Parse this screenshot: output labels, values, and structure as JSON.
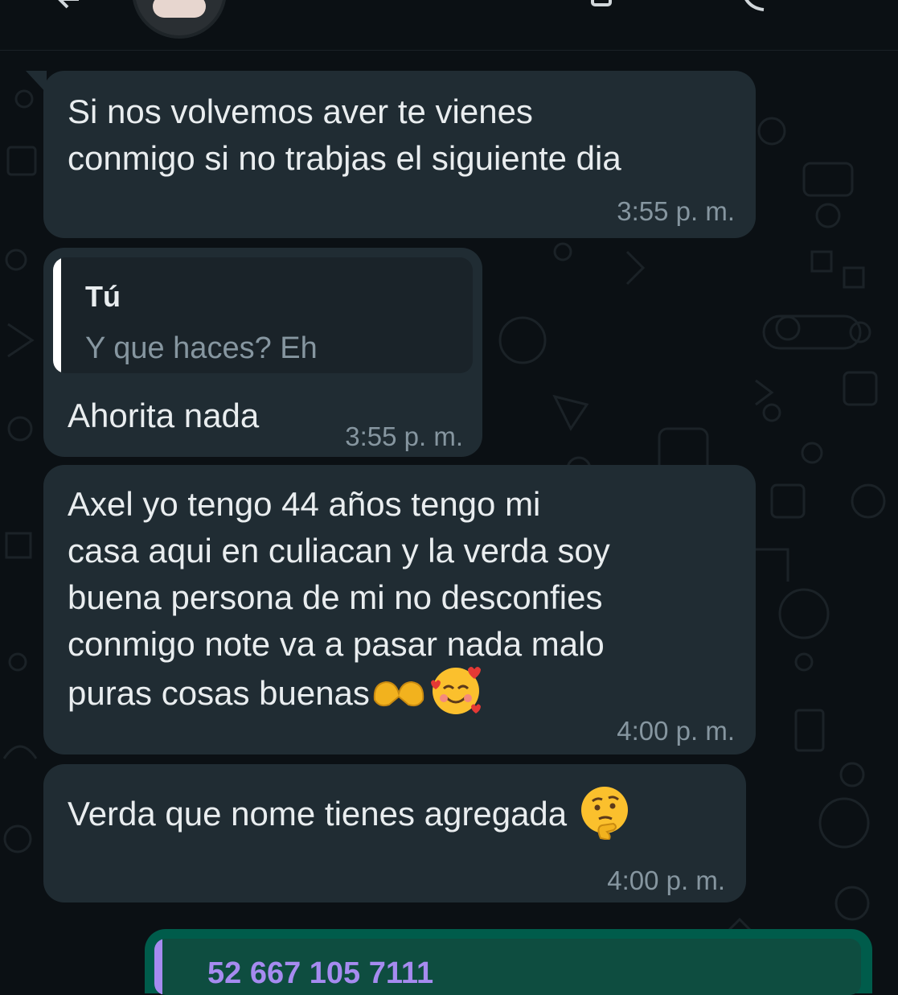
{
  "header": {
    "back_icon": "arrow-left-icon",
    "avatar_icon": "contact-avatar",
    "icons": [
      "video-call-icon",
      "phone-icon",
      "more-icon"
    ]
  },
  "messages": [
    {
      "type": "incoming",
      "text": "Si nos volvemos aver te vienes\nconmigo si no trabjas el siguiente dia",
      "time": "3:55 p. m."
    },
    {
      "type": "incoming",
      "quote_author": "Tú",
      "quote_text": "Y que haces? Eh",
      "text": "Ahorita nada",
      "time": "3:55 p. m."
    },
    {
      "type": "incoming",
      "text": "Axel yo tengo 44 años tengo mi\ncasa aqui en culiacan y la verda soy\nbuena persona de mi no desconfies\nconmigo note va a pasar nada malo\npuras cosas buenas",
      "emojis": [
        "heart-hands-emoji",
        "smiling-face-with-hearts-emoji"
      ],
      "time": "4:00 p. m."
    },
    {
      "type": "incoming",
      "text": "Verda que nome tienes agregada",
      "emojis": [
        "thinking-face-emoji"
      ],
      "time": "4:00 p. m."
    }
  ],
  "outgoing_partial": {
    "quote_text": "52 667 105 7111"
  },
  "colors": {
    "background": "#0b1014",
    "incoming_bubble": "#202c33",
    "outgoing_bubble": "#005c4b",
    "timestamp": "#8696a0",
    "quote_accent_outgoing": "#a68bf0"
  }
}
